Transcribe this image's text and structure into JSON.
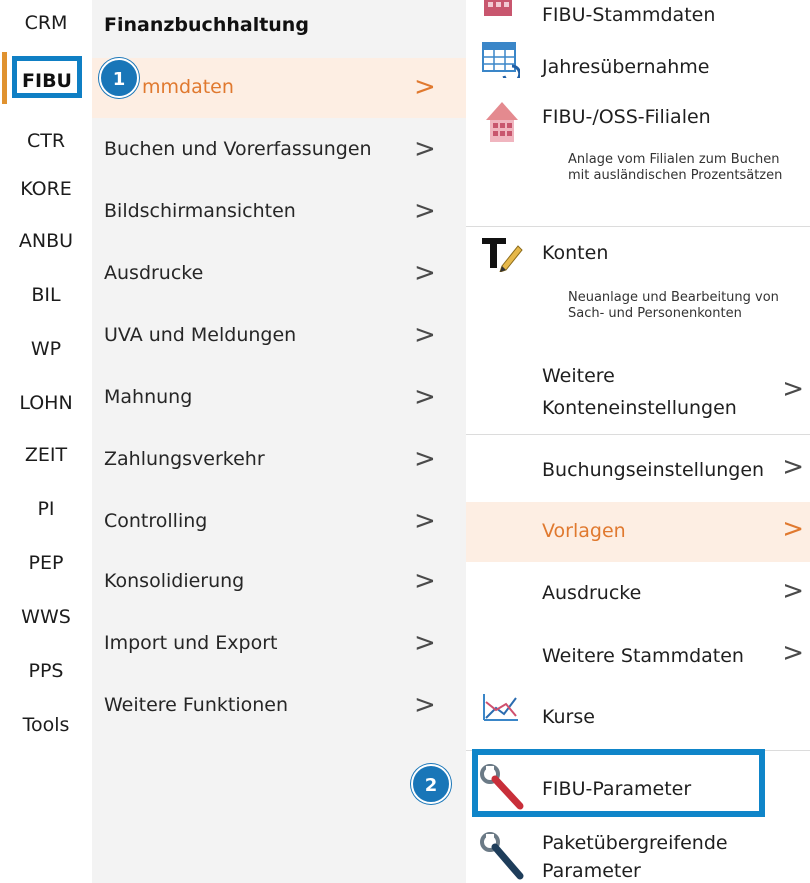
{
  "rail": {
    "items": [
      {
        "label": "CRM"
      },
      {
        "label": "FIBU"
      },
      {
        "label": "CTR"
      },
      {
        "label": "KORE"
      },
      {
        "label": "ANBU"
      },
      {
        "label": "BIL"
      },
      {
        "label": "WP"
      },
      {
        "label": "LOHN"
      },
      {
        "label": "ZEIT"
      },
      {
        "label": "PI"
      },
      {
        "label": "PEP"
      },
      {
        "label": "WWS"
      },
      {
        "label": "PPS"
      },
      {
        "label": "Tools"
      }
    ],
    "active_index": 1
  },
  "menu": {
    "title": "Finanzbuchhaltung",
    "items": [
      {
        "label": "Stammdaten",
        "visible_label": "mmdaten"
      },
      {
        "label": "Buchen und Vorerfassungen"
      },
      {
        "label": "Bildschirmansichten"
      },
      {
        "label": "Ausdrucke"
      },
      {
        "label": "UVA und Meldungen"
      },
      {
        "label": "Mahnung"
      },
      {
        "label": "Zahlungsverkehr"
      },
      {
        "label": "Controlling"
      },
      {
        "label": "Konsolidierung"
      },
      {
        "label": "Import und Export"
      },
      {
        "label": "Weitere Funktionen"
      }
    ],
    "chevron": ">"
  },
  "submenu": {
    "fibu_stammdaten": "FIBU-Stammdaten",
    "jahresuebernahme": "Jahresübernahme",
    "filialen": "FIBU-/OSS-Filialen",
    "filialen_desc": "Anlage vom Filialen zum Buchen mit ausländischen Prozentsätzen",
    "konten": "Konten",
    "konten_desc": "Neuanlage und Bearbeitung von Sach- und Personenkonten",
    "weitere_konten_1": "Weitere",
    "weitere_konten_2": "Konteneinstellungen",
    "buchungseinstellungen": "Buchungseinstellungen",
    "vorlagen": "Vorlagen",
    "ausdrucke": "Ausdrucke",
    "weitere_stammdaten": "Weitere Stammdaten",
    "kurse": "Kurse",
    "fibu_parameter": "FIBU-Parameter",
    "paket_1": "Paketübergreifende",
    "paket_2": "Parameter"
  },
  "callouts": {
    "first": "1",
    "second": "2"
  },
  "colors": {
    "accent_orange": "#e0792f",
    "highlight_blue": "#0f85c9",
    "callout_blue": "#1976b8"
  }
}
